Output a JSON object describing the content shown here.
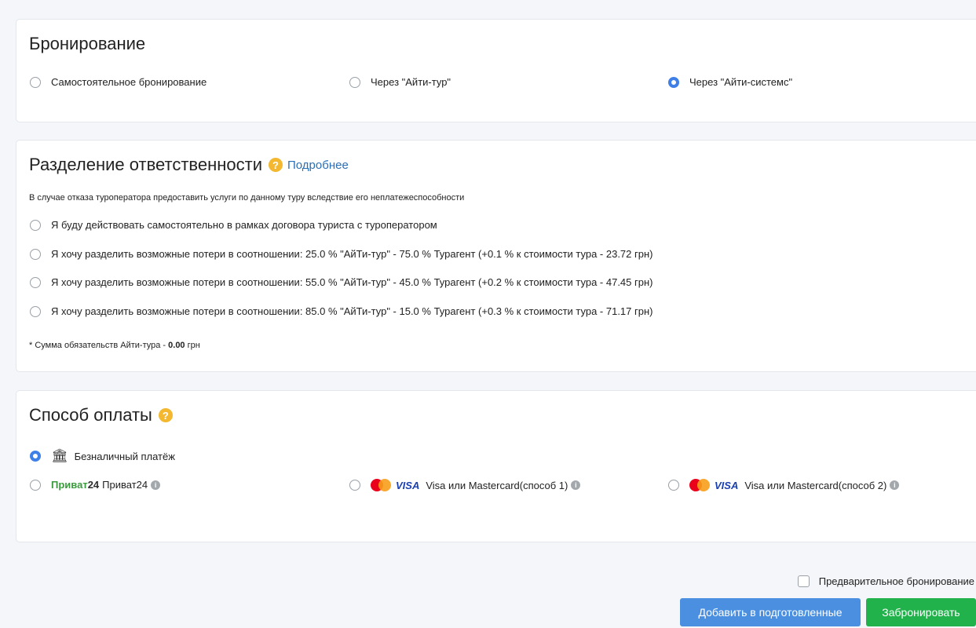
{
  "booking": {
    "title": "Бронирование",
    "options": [
      "Самостоятельное бронирование",
      "Через \"Айти-тур\"",
      "Через \"Айти-системс\""
    ],
    "selected_index": 2
  },
  "responsibility": {
    "title": "Разделение ответственности",
    "more_link": "Подробнее",
    "description": "В случае отказа туроператора предоставить услуги по данному туру вследствие его неплатежеспособности",
    "options": [
      "Я буду действовать самостоятельно в рамках договора туриста с туроператором",
      "Я хочу разделить возможные потери в соотношении: 25.0 % \"АйТи-тур\" - 75.0 % Турагент (+0.1 % к стоимости тура - 23.72 грн)",
      "Я хочу разделить возможные потери в соотношении: 55.0 % \"АйТи-тур\" - 45.0 % Турагент (+0.2 % к стоимости тура - 47.45 грн)",
      "Я хочу разделить возможные потери в соотношении: 85.0 % \"АйТи-тур\" - 15.0 % Турагент (+0.3 % к стоимости тура - 71.17 грн)"
    ],
    "note_prefix": "* Сумма обязательств Айти-тура - ",
    "note_amount": "0.00",
    "note_suffix": " грн"
  },
  "payment": {
    "title": "Способ оплаты",
    "methods": {
      "cashless": "Безналичный платёж",
      "privat_logo_a": "Приват",
      "privat_logo_b": "24",
      "privat": "Приват24",
      "visa_mark": "VISA",
      "card1": "Visa или Mastercard(способ 1)",
      "card2": "Visa или Mastercard(способ 2)"
    },
    "selected": "cashless"
  },
  "footer": {
    "preliminary_label": "Предварительное бронирование",
    "preliminary_checked": false,
    "add_button": "Добавить в подготовленные",
    "book_button": "Забронировать"
  },
  "colors": {
    "accent": "#3f7fe8",
    "add_button": "#4a8fe0",
    "book_button": "#22b24c",
    "help_icon": "#f3b830"
  }
}
